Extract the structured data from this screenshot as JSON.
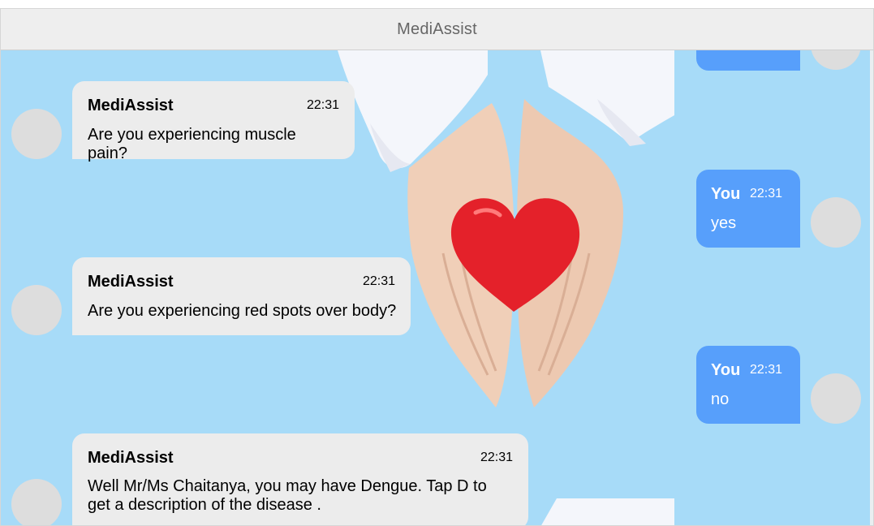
{
  "header": {
    "title": "MediAssist"
  },
  "messages": [
    {
      "sender": "MediAssist",
      "time": "22:31",
      "text": "Are you experiencing muscle pain?"
    },
    {
      "sender": "You",
      "time": "22:31",
      "text": "yes"
    },
    {
      "sender": "MediAssist",
      "time": "22:31",
      "text": "Are you experiencing red spots over body?"
    },
    {
      "sender": "You",
      "time": "22:31",
      "text": "no"
    },
    {
      "sender": "MediAssist",
      "time": "22:31",
      "text": "Well Mr/Ms Chaitanya, you may have Dengue. Tap D to get a description of the disease ."
    }
  ],
  "colors": {
    "chat_background": "#a7dbf8",
    "bot_bubble": "#ececec",
    "user_bubble": "#579ffb",
    "avatar": "#dddddd",
    "header": "#eeeeee"
  }
}
